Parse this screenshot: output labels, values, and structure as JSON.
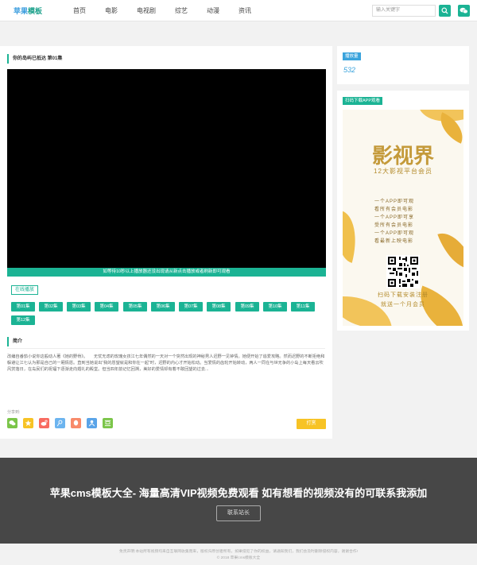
{
  "header": {
    "logo_main": "苹果",
    "logo_accent": "模板",
    "nav": [
      "首页",
      "电影",
      "电视剧",
      "综艺",
      "动漫",
      "资讯"
    ],
    "search_placeholder": "输入关键字",
    "accent_color": "#1bb394"
  },
  "player": {
    "title": "你的岛屿已抵达 第01集",
    "notice": "如等待10秒以上播放器还没出现请从新点击播放或者刷新即可观看",
    "source_tag": "在线播放",
    "episodes": [
      "第01集",
      "第02集",
      "第03集",
      "第04集",
      "第05集",
      "第06集",
      "第07集",
      "第08集",
      "第09集",
      "第10集",
      "第11集",
      "第12集"
    ]
  },
  "intro": {
    "title": "简介",
    "text": "改编自番茄小说你这般动人著《她的野骨》。　　无忧无虑的玫瑰女孩江七年偶然的一天对一个突然出现的神秘男人迟野一见钟情。她便开始了追爱攻略。然而迟野的不断拒绝和躲避让江七认为那是自己的一厢情愿。直到当她说出“我的愿望就是和你在一起”时，迟野的内心才开始松动。当爱情的齿轮开始转动，两人一同在与世无争的小岛上每天看云吹风赏落日，在岛民们的祝福下逐渐走向婚礼的殿堂。但当四年前记忆回溯，美好的爱情却有着不敢回望的过去..."
  },
  "share": {
    "label": "分享到:",
    "icons": [
      {
        "name": "wechat-share-icon",
        "color": "#7bc549"
      },
      {
        "name": "qzone-share-icon",
        "color": "#f7c325"
      },
      {
        "name": "weibo-share-icon",
        "color": "#f86a60"
      },
      {
        "name": "tencent-weibo-share-icon",
        "color": "#6cb4ef"
      },
      {
        "name": "qq-share-icon",
        "color": "#f88a6a"
      },
      {
        "name": "renren-share-icon",
        "color": "#5aa4e8"
      },
      {
        "name": "douban-share-icon",
        "color": "#7bc549"
      }
    ],
    "reward_label": "打赏"
  },
  "side": {
    "play_label": "播放量",
    "play_count": "532",
    "app_label": "扫码下载APP观看",
    "poster": {
      "title": "影视界",
      "subtitle": "12大影视平台会员",
      "lines": [
        "一个APP即可观",
        "看所有会员电影",
        "一个APP即可享",
        "受所有会员电影",
        "一个APP即可观",
        "看最新上映电影"
      ],
      "foot1": "扫码下载安装注册",
      "foot2": "就送一个月会员"
    }
  },
  "footer": {
    "banner_title": "苹果cms模板大全- 海量高清VIP视频免费观看 如有想看的视频没有的可联系我添加",
    "contact_label": "联系站长",
    "disclaimer": "免责声明:本站所有视频均来自互联网收集而来，版权归原创者所有，如果侵犯了你的权益，请通知我们，我们会及时删除侵权内容，谢谢合作!",
    "copyright": "© 2018 苹果cms模板大全"
  }
}
